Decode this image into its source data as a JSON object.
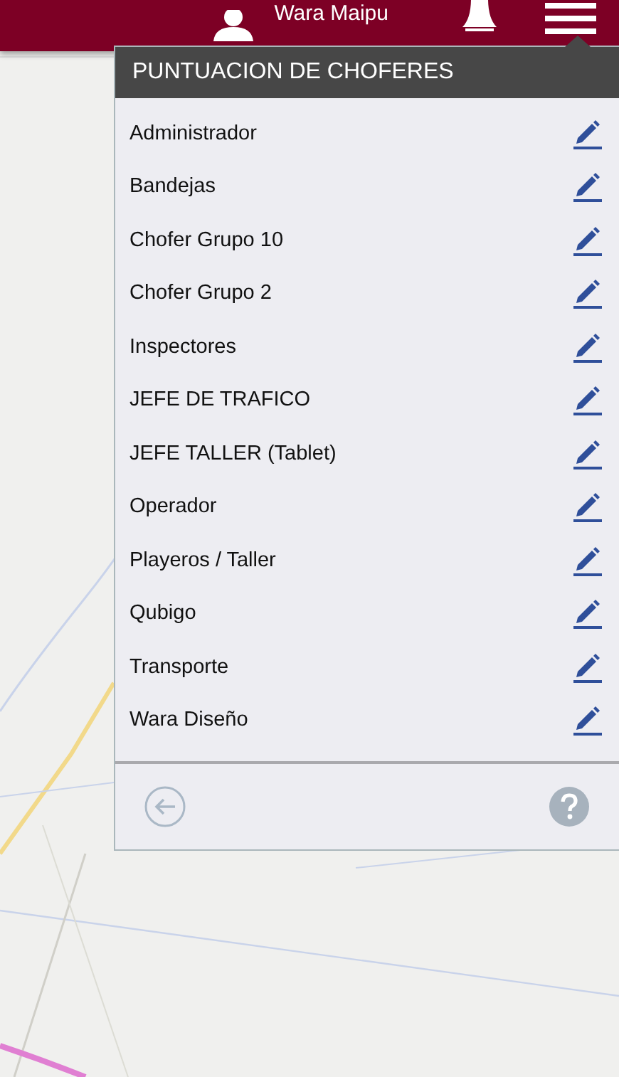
{
  "header": {
    "user_name": "Wara Maipu"
  },
  "menu": {
    "title": "PUNTUACION DE CHOFERES",
    "items": [
      {
        "label": "Administrador"
      },
      {
        "label": "Bandejas"
      },
      {
        "label": "Chofer Grupo 10"
      },
      {
        "label": "Chofer Grupo 2"
      },
      {
        "label": "Inspectores"
      },
      {
        "label": "JEFE DE TRAFICO"
      },
      {
        "label": "JEFE TALLER (Tablet)"
      },
      {
        "label": "Operador"
      },
      {
        "label": "Playeros / Taller"
      },
      {
        "label": "Qubigo"
      },
      {
        "label": "Transporte"
      },
      {
        "label": "Wara Diseño"
      }
    ]
  }
}
